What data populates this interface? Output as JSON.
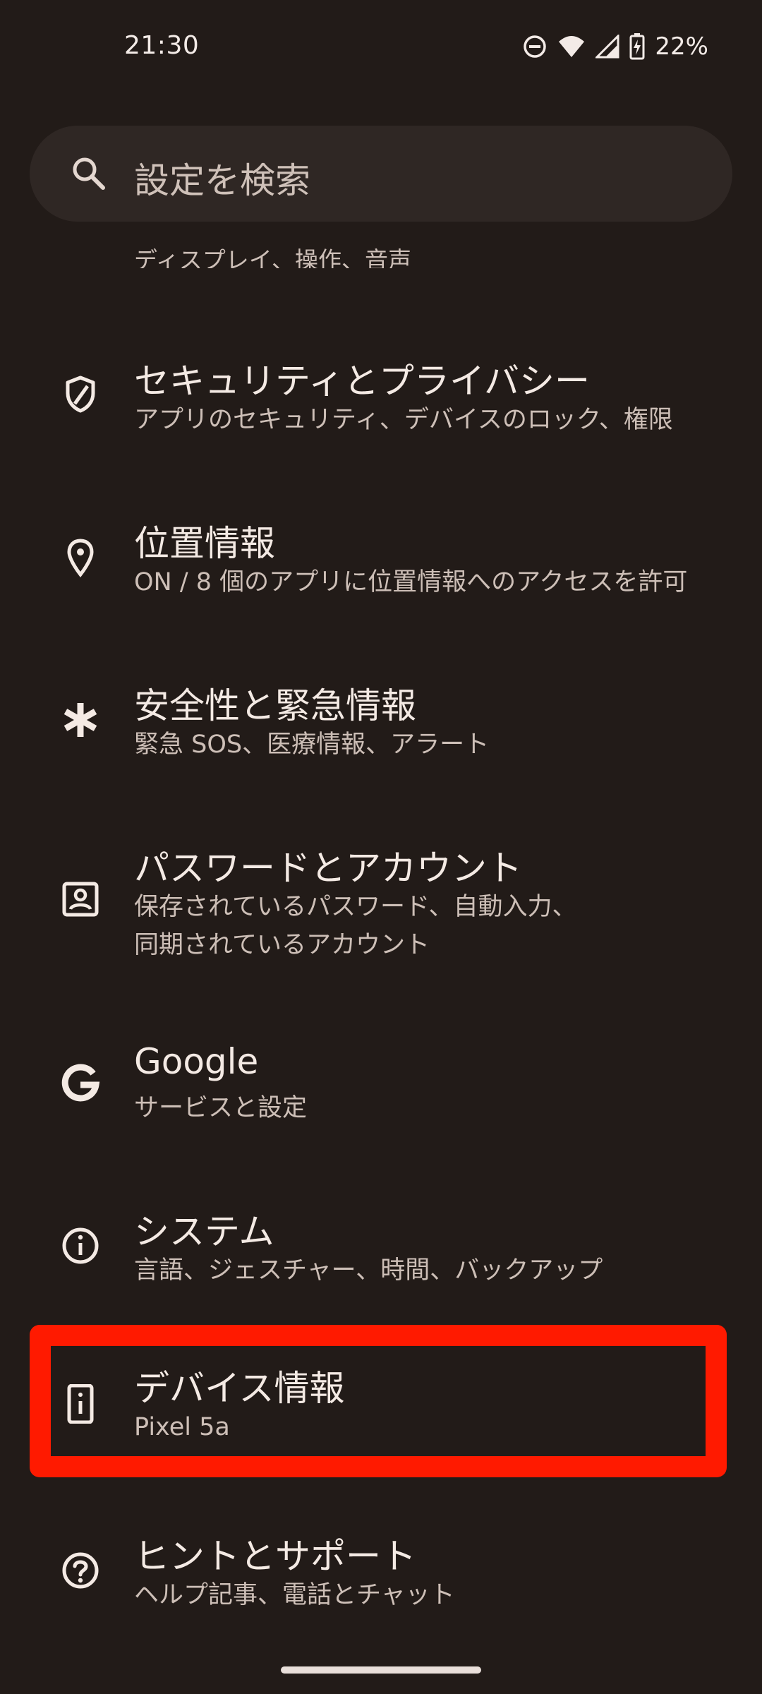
{
  "status_bar": {
    "time": "21:30",
    "battery_percent": "22%",
    "icons": [
      "do-not-disturb-icon",
      "wifi-icon",
      "signal-icon",
      "battery-charging-icon"
    ]
  },
  "search": {
    "placeholder": "設定を検索",
    "icon": "search-icon"
  },
  "partial_item": {
    "subtitle": "ディスプレイ、操作、音声"
  },
  "items": [
    {
      "icon": "shield-icon",
      "title": "セキュリティとプライバシー",
      "subtitle": "アプリのセキュリティ、デバイスのロック、権限"
    },
    {
      "icon": "location-pin-icon",
      "title": "位置情報",
      "subtitle": "ON / 8 個のアプリに位置情報へのアクセスを許可"
    },
    {
      "icon": "asterisk-icon",
      "title": "安全性と緊急情報",
      "subtitle": "緊急 SOS、医療情報、アラート"
    },
    {
      "icon": "account-box-icon",
      "title": "パスワードとアカウント",
      "subtitle_line1": "保存されているパスワード、自動入力、",
      "subtitle_line2": "同期されているアカウント"
    },
    {
      "icon": "google-icon",
      "title": "Google",
      "subtitle": "サービスと設定"
    },
    {
      "icon": "info-icon",
      "title": "システム",
      "subtitle": "言語、ジェスチャー、時間、バックアップ"
    },
    {
      "icon": "device-info-icon",
      "title": "デバイス情報",
      "subtitle": "Pixel 5a"
    },
    {
      "icon": "help-icon",
      "title": "ヒントとサポート",
      "subtitle": "ヘルプ記事、電話とチャット"
    }
  ],
  "colors": {
    "background": "#221b18",
    "search_bg": "#2f2724",
    "highlight": "#ff1a00"
  }
}
